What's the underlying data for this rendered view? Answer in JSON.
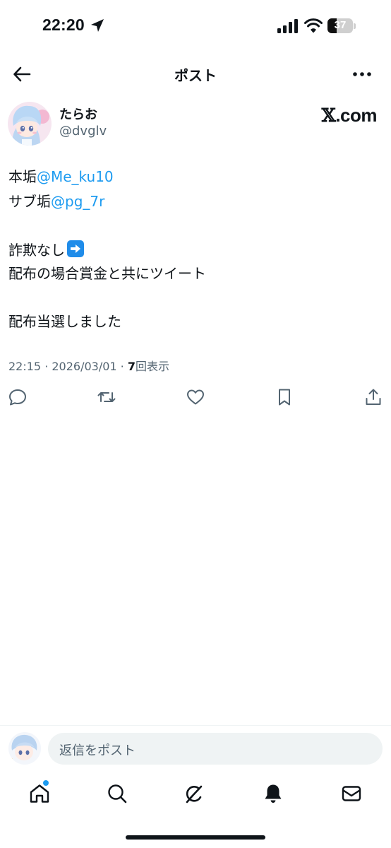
{
  "status_bar": {
    "time": "22:20",
    "battery_percent": 37,
    "battery_label": "37",
    "signal_bars": 4
  },
  "header": {
    "title": "ポスト",
    "back_icon": "arrow-left-icon",
    "more_icon": "more-horizontal-icon"
  },
  "author": {
    "display_name": "たらお",
    "handle": "@dvglv"
  },
  "watermark": {
    "x": "𝕏",
    "suffix": ".com"
  },
  "tweet": {
    "line1_prefix": "本垢",
    "line1_mention": "@Me_ku10",
    "line2_prefix": "サブ垢",
    "line2_mention": "@pg_7r",
    "line3": "詐欺なし",
    "line3_emoji": "arrow-right-emoji",
    "line4": "配布の場合賞金と共にツイート",
    "line5": "配布当選しました"
  },
  "meta": {
    "time": "22:15",
    "sep1": " · ",
    "date": "2026/03/01",
    "sep2": " · ",
    "view_count": "7",
    "views_label": "回表示"
  },
  "actions": [
    "reply-icon",
    "retweet-icon",
    "like-icon",
    "bookmark-icon",
    "share-icon"
  ],
  "reply_bar": {
    "placeholder": "返信をポスト"
  },
  "tab_bar": {
    "tabs": [
      "home-icon",
      "search-icon",
      "grok-icon",
      "notifications-icon",
      "messages-icon"
    ],
    "has_notification_dot": true
  },
  "colors": {
    "accent": "#1d9bf0",
    "text": "#0f1419",
    "secondary": "#536471",
    "input_bg": "#eff3f4"
  }
}
